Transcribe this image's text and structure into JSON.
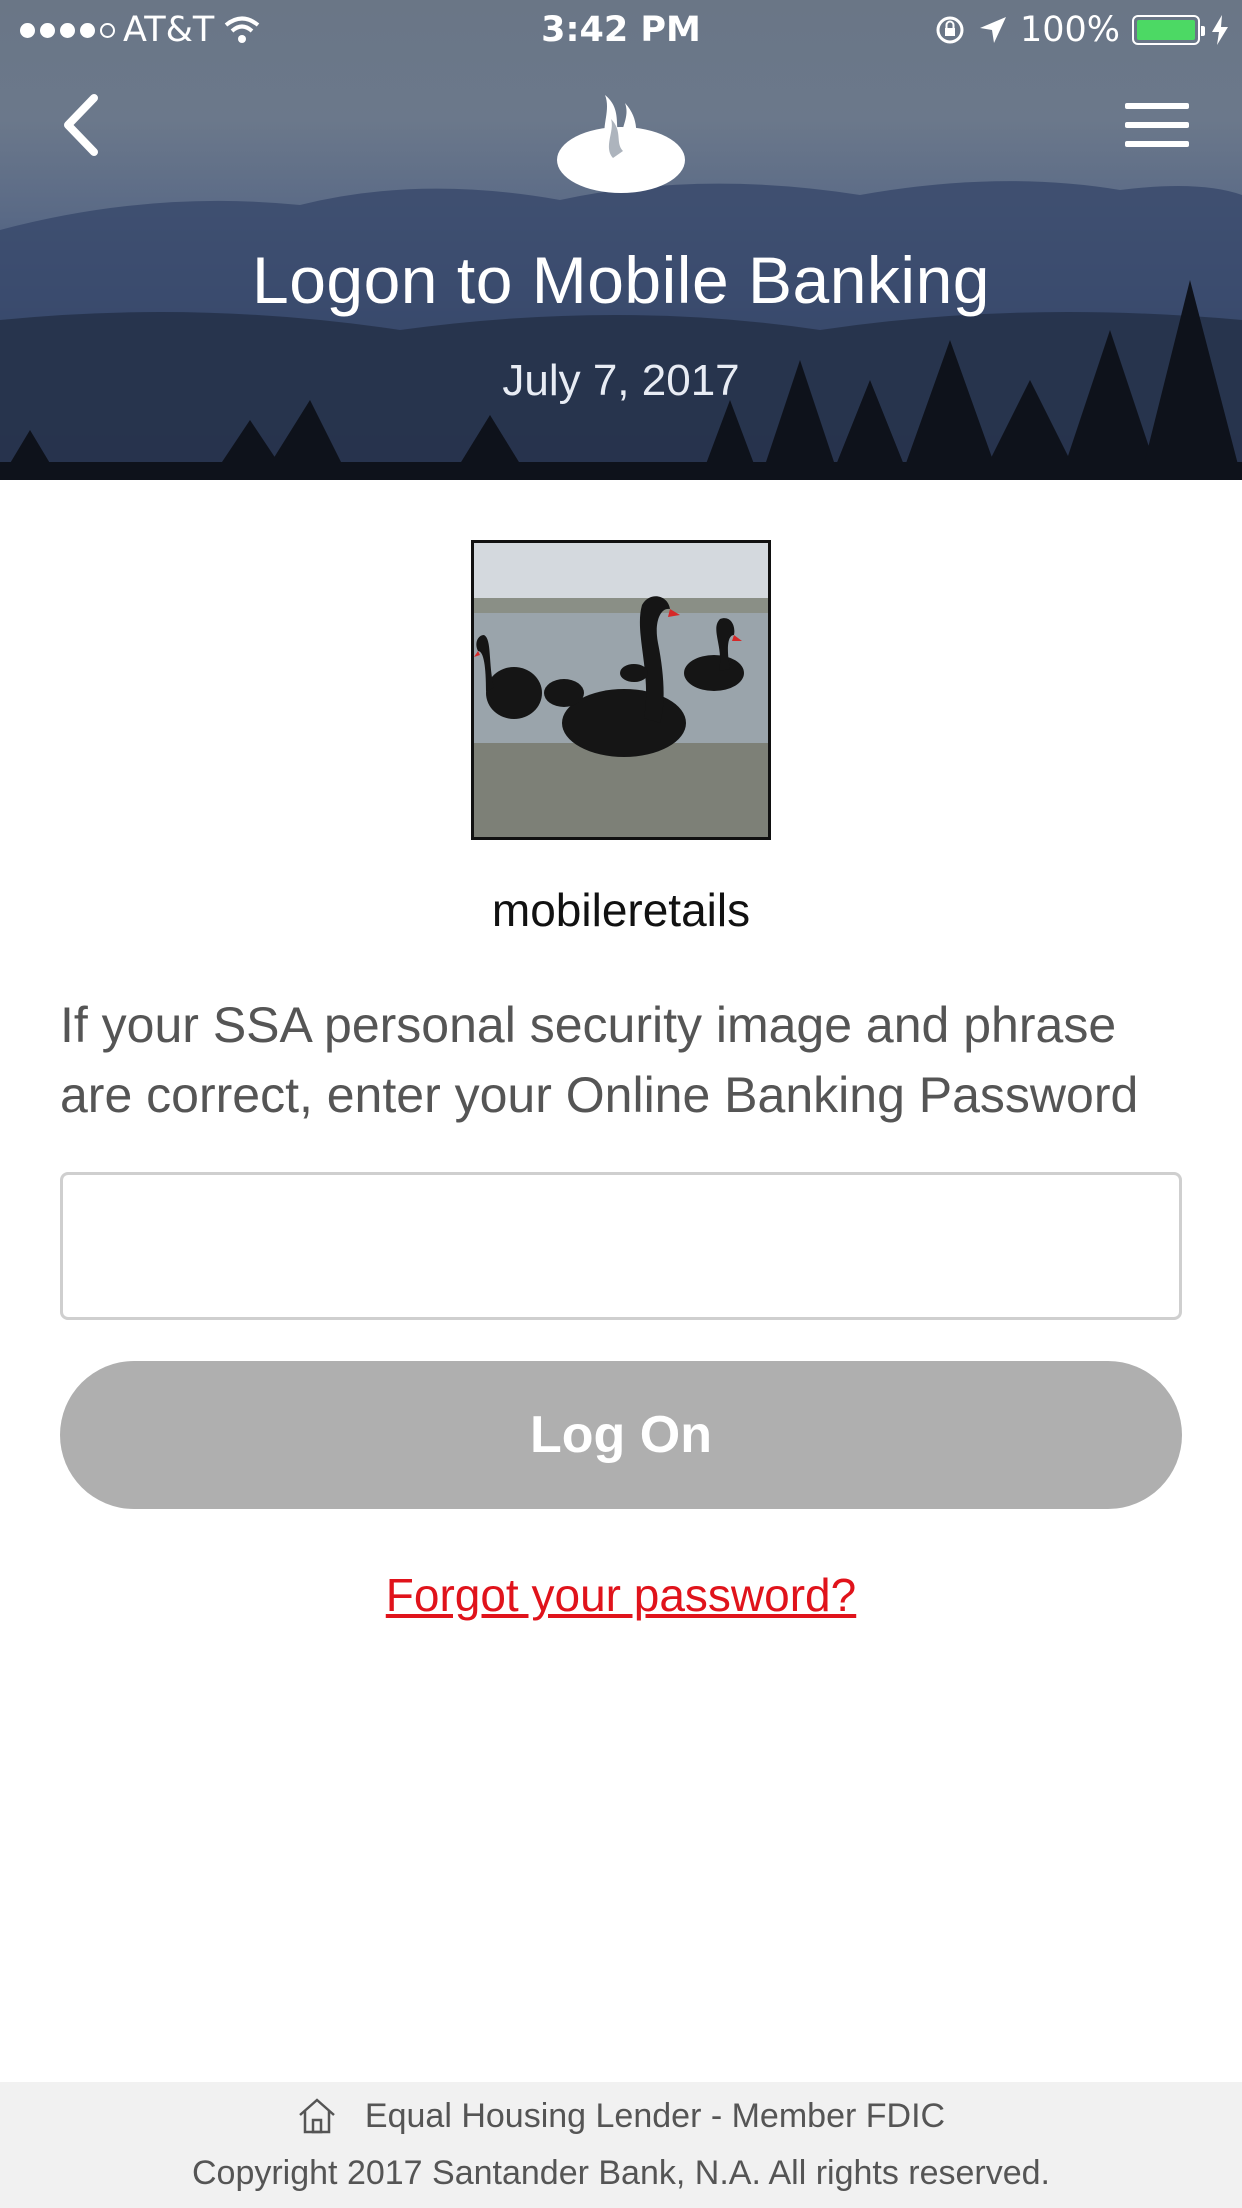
{
  "status_bar": {
    "carrier": "AT&T",
    "time": "3:42 PM",
    "battery_percent": "100%",
    "battery_level": 1.0,
    "signal_bars": 4,
    "signal_max": 5
  },
  "header": {
    "title": "Logon to Mobile Banking",
    "date": "July 7, 2017",
    "back_icon": "chevron-left-icon",
    "menu_icon": "hamburger-menu-icon",
    "logo_icon": "flame-logo-icon"
  },
  "main": {
    "username": "mobileretails",
    "instructions": "If your SSA personal security image and phrase are correct, enter your Online Banking Password",
    "password_value": "",
    "logon_label": "Log On",
    "forgot_label": "Forgot your password?"
  },
  "footer": {
    "line1": "Equal Housing Lender - Member FDIC",
    "line2": "Copyright 2017 Santander Bank, N.A. All rights reserved.",
    "icon": "house-icon"
  },
  "colors": {
    "accent_red": "#e0131b",
    "button_disabled": "#afafaf",
    "footer_bg": "#f1f1f1"
  }
}
